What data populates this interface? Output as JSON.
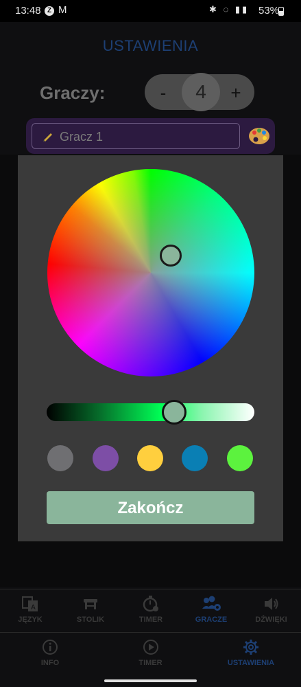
{
  "status_bar": {
    "time": "13:48",
    "app_icon_letter": "Z",
    "mail_icon": "M",
    "battery": "53%"
  },
  "header": {
    "title": "USTAWIENIA"
  },
  "players": {
    "label": "Graczy:",
    "minus_label": "-",
    "plus_label": "+",
    "count": "4"
  },
  "player_card": {
    "name": "Gracz 1"
  },
  "color_picker": {
    "wheel_selected_color": "#8ab59b",
    "swatches": [
      "#6f6f72",
      "#7d4ea6",
      "#ffcf3e",
      "#0a7fb4",
      "#5cf23e"
    ],
    "done_label": "Zakończ"
  },
  "bottom_tabs_top": [
    {
      "label": "JĘZYK",
      "icon": "language-icon"
    },
    {
      "label": "STOLIK",
      "icon": "table-icon"
    },
    {
      "label": "TIMER",
      "icon": "stopwatch-icon"
    },
    {
      "label": "GRACZE",
      "icon": "players-icon",
      "active": true
    },
    {
      "label": "DŹWIĘKI",
      "icon": "speaker-icon"
    }
  ],
  "bottom_tabs_bottom": [
    {
      "label": "INFO",
      "icon": "info-icon"
    },
    {
      "label": "TIMER",
      "icon": "play-icon"
    },
    {
      "label": "USTAWIENIA",
      "icon": "gear-icon",
      "active": true
    }
  ],
  "colors": {
    "accent_blue": "#1d3f73",
    "card_purple": "#2c1a40",
    "done_button": "#8ab59b"
  }
}
